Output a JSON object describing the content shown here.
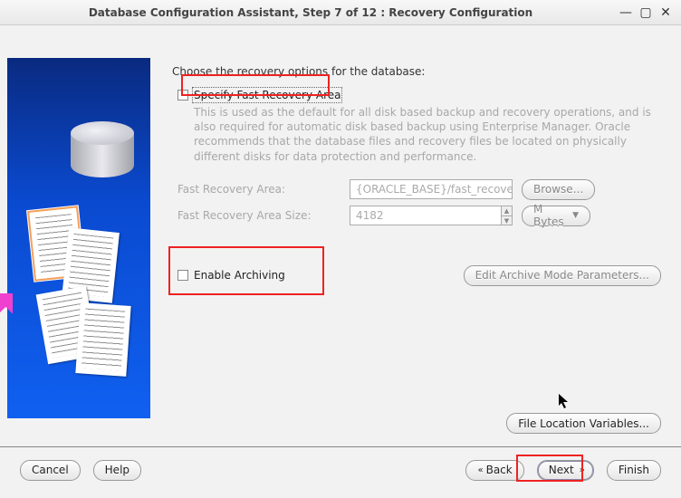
{
  "window": {
    "title": "Database Configuration Assistant, Step 7 of 12 : Recovery Configuration"
  },
  "main": {
    "prompt": "Choose the recovery options for the database:",
    "specify_fra_label": "Specify Fast Recovery Area",
    "fra_help": "This is used as the default for all disk based backup and recovery operations, and is also required for automatic disk based backup using Enterprise Manager. Oracle recommends that the database files and recovery files be located on physically different disks for data protection and performance.",
    "fra_location_label": "Fast Recovery Area:",
    "fra_location_value": "{ORACLE_BASE}/fast_recovery_a",
    "browse_label": "Browse...",
    "fra_size_label": "Fast Recovery Area Size:",
    "fra_size_value": "4182",
    "fra_size_unit": "M Bytes",
    "enable_archiving_label": "Enable Archiving",
    "edit_archive_label": "Edit Archive Mode Parameters...",
    "file_loc_vars_label": "File Location Variables..."
  },
  "footer": {
    "cancel": "Cancel",
    "help": "Help",
    "back": "Back",
    "next": "Next",
    "finish": "Finish"
  }
}
